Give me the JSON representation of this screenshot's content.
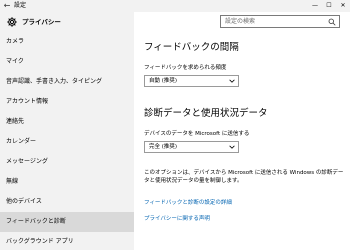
{
  "window": {
    "title": "設定",
    "back_glyph": "←",
    "minimize_glyph": "—",
    "maximize_glyph": "☐",
    "close_glyph": "✕"
  },
  "sidebar": {
    "header_label": "プライバシー",
    "items": [
      {
        "label": "カメラ"
      },
      {
        "label": "マイク"
      },
      {
        "label": "音声認識、手書き入力、タイピング"
      },
      {
        "label": "アカウント情報"
      },
      {
        "label": "連絡先"
      },
      {
        "label": "カレンダー"
      },
      {
        "label": "メッセージング"
      },
      {
        "label": "無線"
      },
      {
        "label": "他のデバイス"
      },
      {
        "label": "フィードバックと診断",
        "active": true
      },
      {
        "label": "バックグラウンド アプリ"
      }
    ]
  },
  "search": {
    "placeholder": "設定の検索"
  },
  "feedback": {
    "heading": "フィードバックの間隔",
    "frequency_label": "フィードバックを求められる頻度",
    "frequency_value": "自動 (推奨)"
  },
  "diagnostics": {
    "heading": "診断データと使用状況データ",
    "send_label": "デバイスのデータを Microsoft に送信する",
    "send_value": "完全 (推奨)",
    "description": "このオプションは、デバイスから Microsoft に送信される Windows の診断データと使用状況データの量を制御します。"
  },
  "links": {
    "feedback_settings": "フィードバックと診断の設定の詳細",
    "privacy_statement": "プライバシーに関する声明"
  },
  "colors": {
    "accent": "#0063b1",
    "sidebar_bg": "#f2f2f2",
    "active_item_bg": "#d9d9d9"
  }
}
